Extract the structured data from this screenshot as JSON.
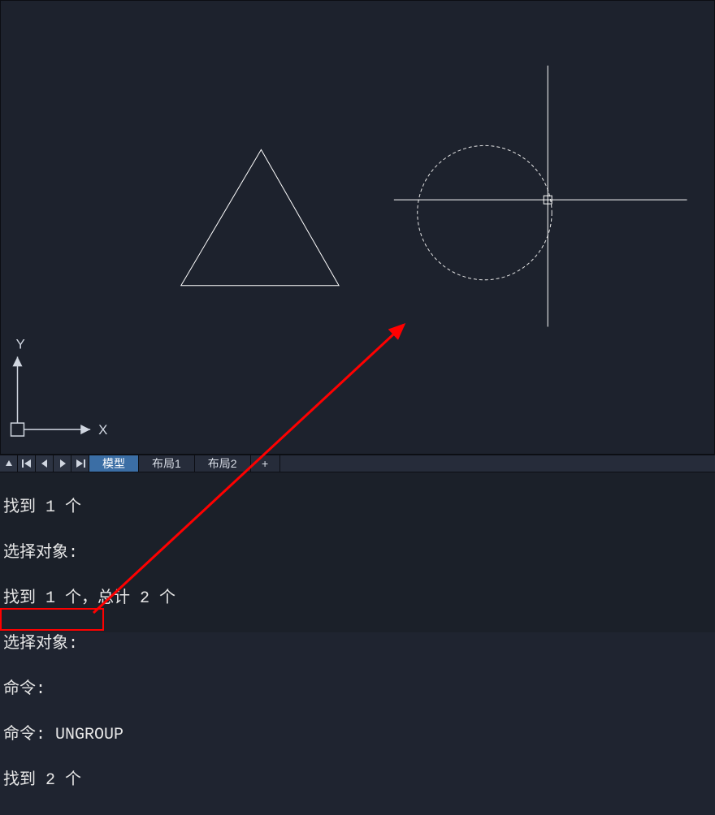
{
  "ucs": {
    "x_label": "X",
    "y_label": "Y"
  },
  "tabs": {
    "model": "模型",
    "layout1": "布局1",
    "layout2": "布局2",
    "plus": "+"
  },
  "cmd_history": {
    "line1": "找到 1 个",
    "line2": "选择对象:",
    "line3": "找到 1 个，总计 2 个",
    "line4": "选择对象:",
    "line5": "命令:",
    "line6_prefix": "命令: ",
    "line6_cmd": "UNGROUP",
    "line7": "找到 2 个"
  }
}
